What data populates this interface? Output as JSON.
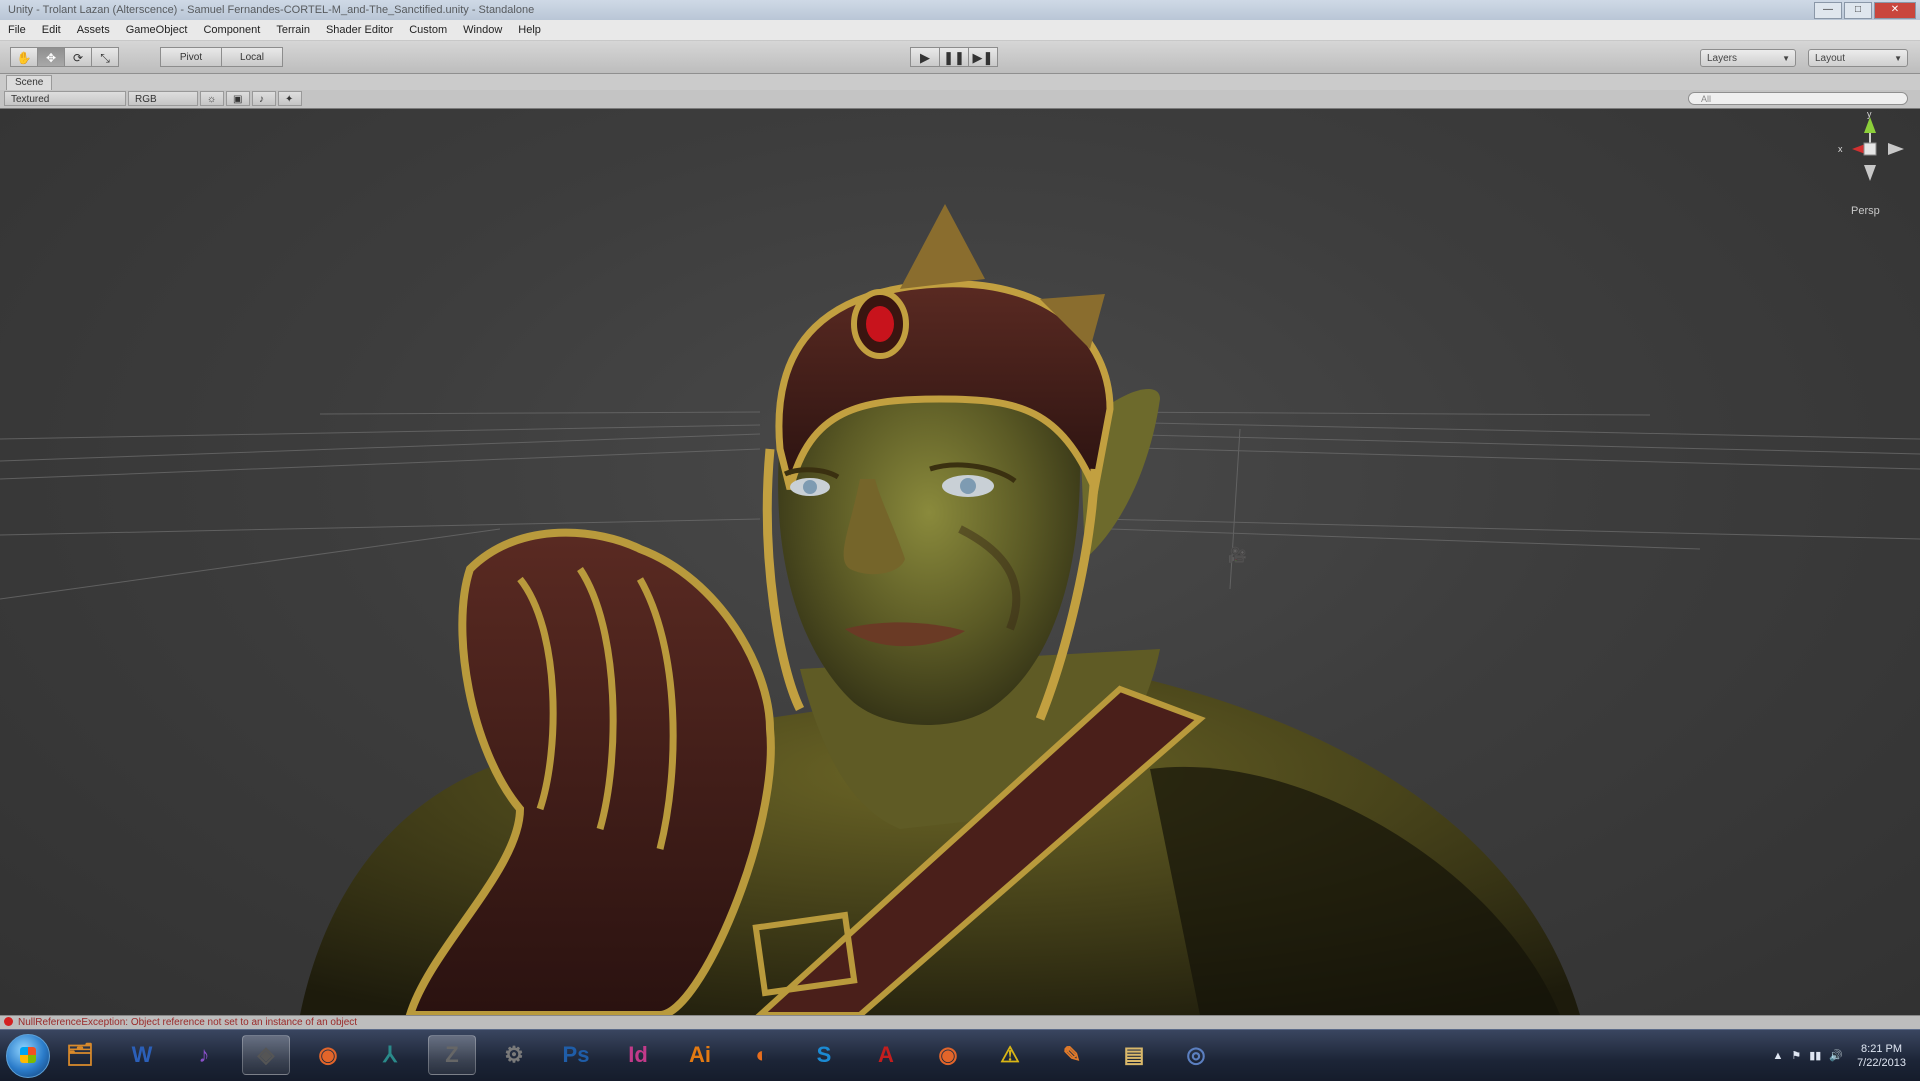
{
  "window": {
    "title": "Unity - Trolant Lazan (Alterscence) - Samuel Fernandes-CORTEL-M_and-The_Sanctified.unity - Standalone",
    "controls": [
      "—",
      "□",
      "✕"
    ]
  },
  "menu": {
    "items": [
      "File",
      "Edit",
      "Assets",
      "GameObject",
      "Component",
      "Terrain",
      "Shader Editor",
      "Custom",
      "Window",
      "Help"
    ]
  },
  "toolbar": {
    "transform_tools": [
      "✋",
      "✥",
      "⟳",
      "⤡"
    ],
    "pivot_label": "Pivot",
    "global_label": "Local",
    "play_controls": [
      "▶",
      "❚❚",
      "▶❚"
    ],
    "layers_label": "Layers",
    "layout_label": "Layout"
  },
  "scene": {
    "tab_label": "Scene",
    "render_mode": "Textured",
    "color_mode": "RGB",
    "search_placeholder": "All",
    "persp_label": "Persp",
    "gizmo_axes": {
      "x": "x",
      "y": "y"
    }
  },
  "status": {
    "error_message": "NullReferenceException: Object reference not set to an instance of an object"
  },
  "taskbar": {
    "apps": [
      {
        "name": "explorer-app",
        "glyph": "🗂",
        "color": "#d98a2b"
      },
      {
        "name": "word-app",
        "glyph": "W",
        "color": "#2b5fb8"
      },
      {
        "name": "media-app",
        "glyph": "♪",
        "color": "#8a4fc9"
      },
      {
        "name": "unity-app",
        "glyph": "◈",
        "color": "#555555"
      },
      {
        "name": "firefox-app",
        "glyph": "◉",
        "color": "#e2652a"
      },
      {
        "name": "maya-app",
        "glyph": "⅄",
        "color": "#2a8a8a"
      },
      {
        "name": "zbrush-app",
        "glyph": "Z",
        "color": "#666666"
      },
      {
        "name": "settings-app",
        "glyph": "⚙",
        "color": "#7a7a7a"
      },
      {
        "name": "photoshop-app",
        "glyph": "Ps",
        "color": "#1f5da8"
      },
      {
        "name": "indesign-app",
        "glyph": "Id",
        "color": "#c23a8a"
      },
      {
        "name": "illustrator-app",
        "glyph": "Ai",
        "color": "#e37a12"
      },
      {
        "name": "blender-app",
        "glyph": "◐",
        "color": "#e86e1c"
      },
      {
        "name": "skype-app",
        "glyph": "S",
        "color": "#1b8ad3"
      },
      {
        "name": "acrobat-app",
        "glyph": "A",
        "color": "#c21e1e"
      },
      {
        "name": "firefox2-app",
        "glyph": "◉",
        "color": "#e2652a"
      },
      {
        "name": "warning-app",
        "glyph": "⚠",
        "color": "#d9b515"
      },
      {
        "name": "paint-app",
        "glyph": "✎",
        "color": "#e07a2a"
      },
      {
        "name": "folder-app",
        "glyph": "▤",
        "color": "#d9b86a"
      },
      {
        "name": "network-app",
        "glyph": "◎",
        "color": "#5b7fc0"
      }
    ],
    "tray_icons": [
      "▲",
      "⚑",
      "▮▮",
      "🔊"
    ],
    "time": "8:21 PM",
    "date": "7/22/2013"
  }
}
